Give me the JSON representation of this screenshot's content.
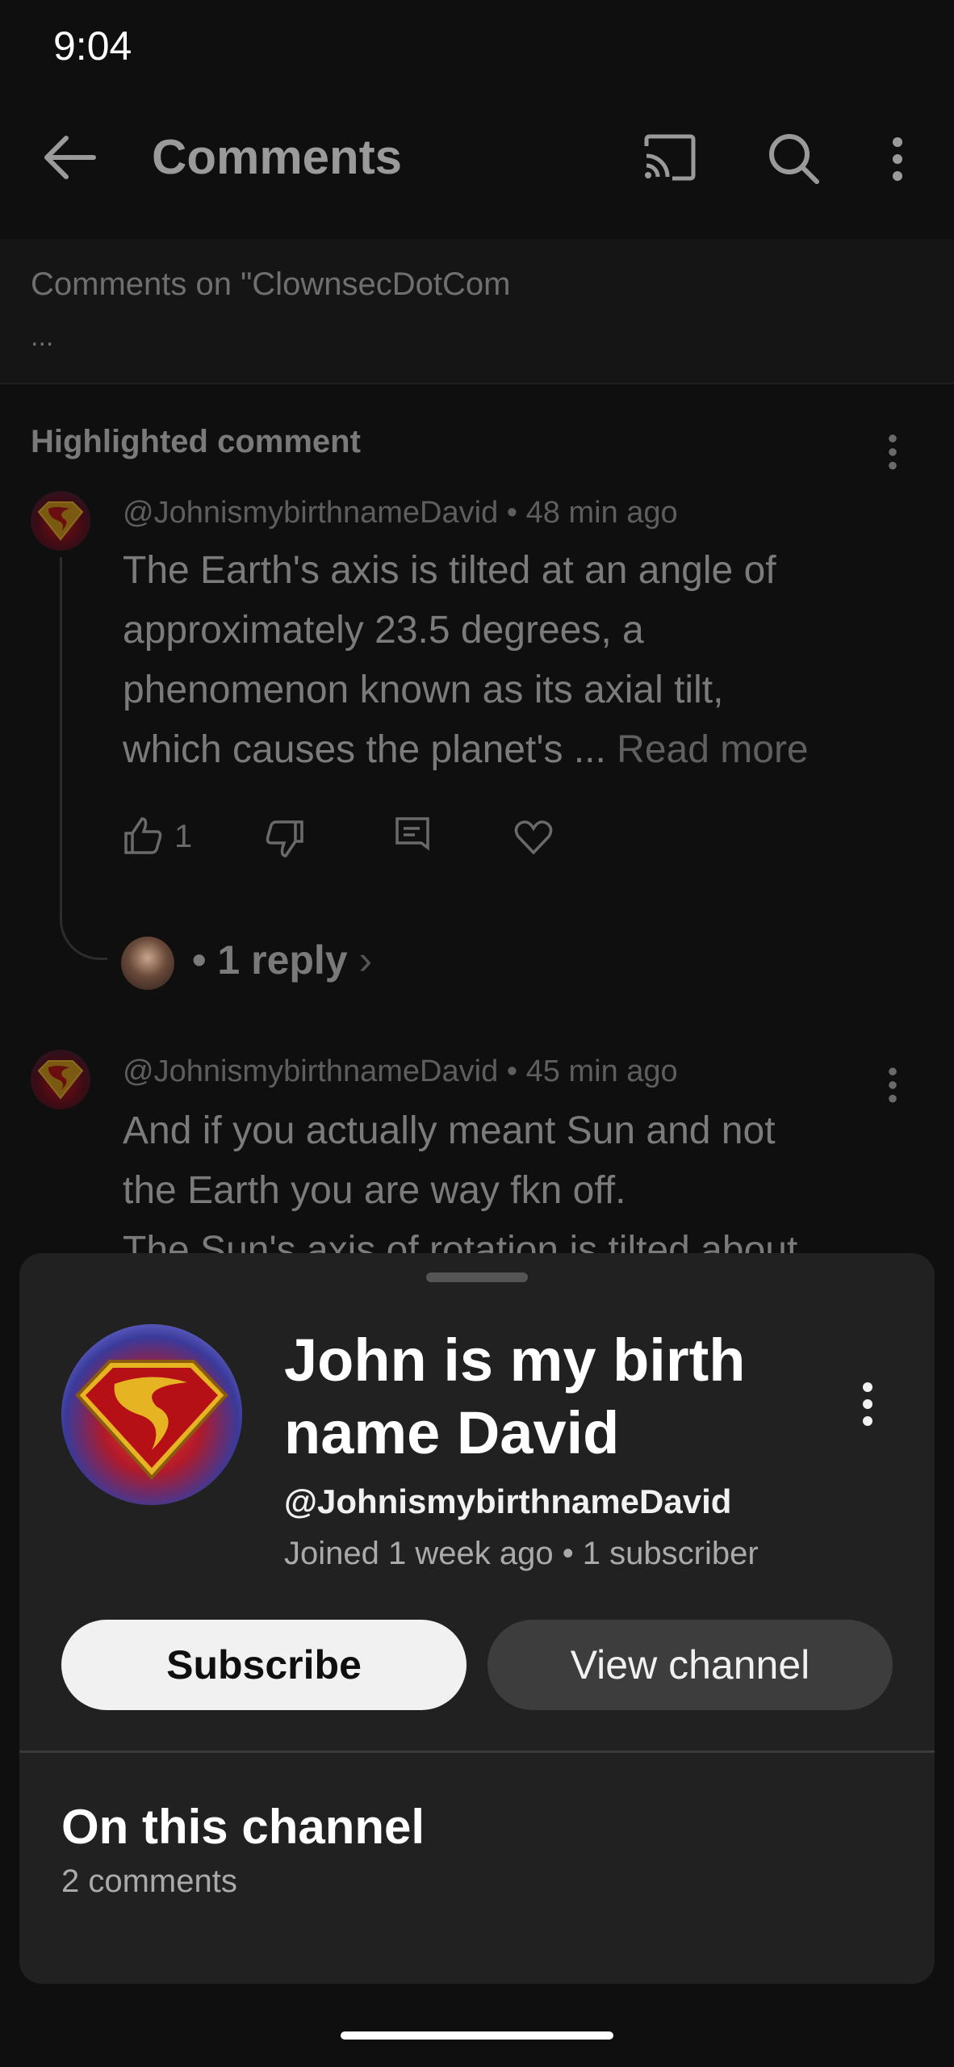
{
  "status_bar": {
    "time": "9:04"
  },
  "app_bar": {
    "title": "Comments",
    "icons": [
      "back-arrow-icon",
      "cast-icon",
      "search-icon",
      "more-vert-icon"
    ]
  },
  "context": {
    "text": "Comments on \"ClownsecDotCom",
    "ellipsis": "..."
  },
  "highlighted": {
    "section_title": "Highlighted comment",
    "comment": {
      "author": "@JohnismybirthnameDavid",
      "time": "48 min ago",
      "lines": [
        "The Earth's axis is tilted at an angle of",
        "approximately 23.5 degrees, a",
        "phenomenon known as its axial tilt,",
        "which causes the planet's ..."
      ],
      "read_more": "Read more",
      "likes": "1"
    },
    "reply_label": "1 reply"
  },
  "second_comment": {
    "author": "@JohnismybirthnameDavid",
    "time": "45 min ago",
    "lines": [
      "And if you actually meant Sun and not",
      "the Earth you are way fkn off.",
      "The Sun's axis of rotation is tilted about"
    ]
  },
  "sheet": {
    "channel_name_line1": "John is my birth",
    "channel_name_line2": "name David",
    "handle": "@JohnismybirthnameDavid",
    "joined": "Joined 1 week ago • 1 subscriber",
    "subscribe_label": "Subscribe",
    "view_channel_label": "View channel",
    "section_title": "On this channel",
    "comments_count": "2 comments"
  },
  "colors": {
    "background": "#0f0f0f",
    "sheet": "#212121",
    "subscribe_bg": "#f1f1f1"
  }
}
